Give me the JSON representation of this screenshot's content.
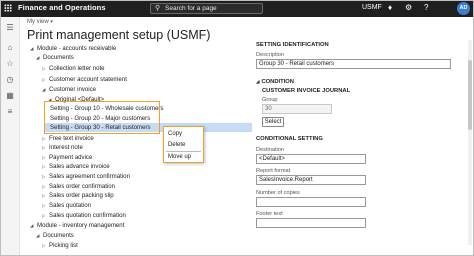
{
  "topbar": {
    "app_title": "Finance and Operations",
    "search_placeholder": "Search for a page",
    "company": "USMF",
    "icons": [
      "grid-icon",
      "search-icon",
      "bell-icon",
      "gear-icon",
      "help-icon"
    ],
    "avatar_initials": "AD"
  },
  "nav": {
    "icons": [
      "hamburger-icon",
      "home-icon",
      "star-icon",
      "clock-icon",
      "modules-icon",
      "list-icon"
    ]
  },
  "breadcrumb": "My view",
  "page_title": "Print management setup (USMF)",
  "tree": {
    "rows": [
      "Module - accounts receivable",
      "Documents",
      "Collection letter note",
      "Customer account statement",
      "Customer invoice",
      "Original <Default>",
      "Setting - Group 10 - Wholesale customers",
      "Setting - Group 20 - Major customers",
      "Setting - Group 30 - Retail customers",
      "Free text invoice",
      "Interest note",
      "Payment advice",
      "Sales advance invoice",
      "Sales agreement confirmation",
      "Sales order confirmation",
      "Sales order packing slip",
      "Sales quotation",
      "Sales quotation confirmation",
      "Module - inventory management",
      "Documents",
      "Picking list"
    ]
  },
  "context_menu": {
    "items": [
      "Copy",
      "Delete",
      "Move up"
    ]
  },
  "right_panel": {
    "setting_identification": "SETTING IDENTIFICATION",
    "description_label": "Description",
    "description_value": "Group 30 - Retail customers",
    "condition_head": "CONDITION",
    "condition_sub": "CUSTOMER INVOICE JOURNAL",
    "group_label": "Group",
    "group_value": "30",
    "select_button": "Select",
    "conditional_setting": "CONDITIONAL SETTING",
    "destination_label": "Destination",
    "destination_value": "<Default>",
    "report_format_label": "Report format",
    "report_format_value": "SalesInvoice.Report",
    "copies_label": "Number of copies",
    "copies_value": "",
    "footer_label": "Footer text",
    "footer_value": ""
  }
}
